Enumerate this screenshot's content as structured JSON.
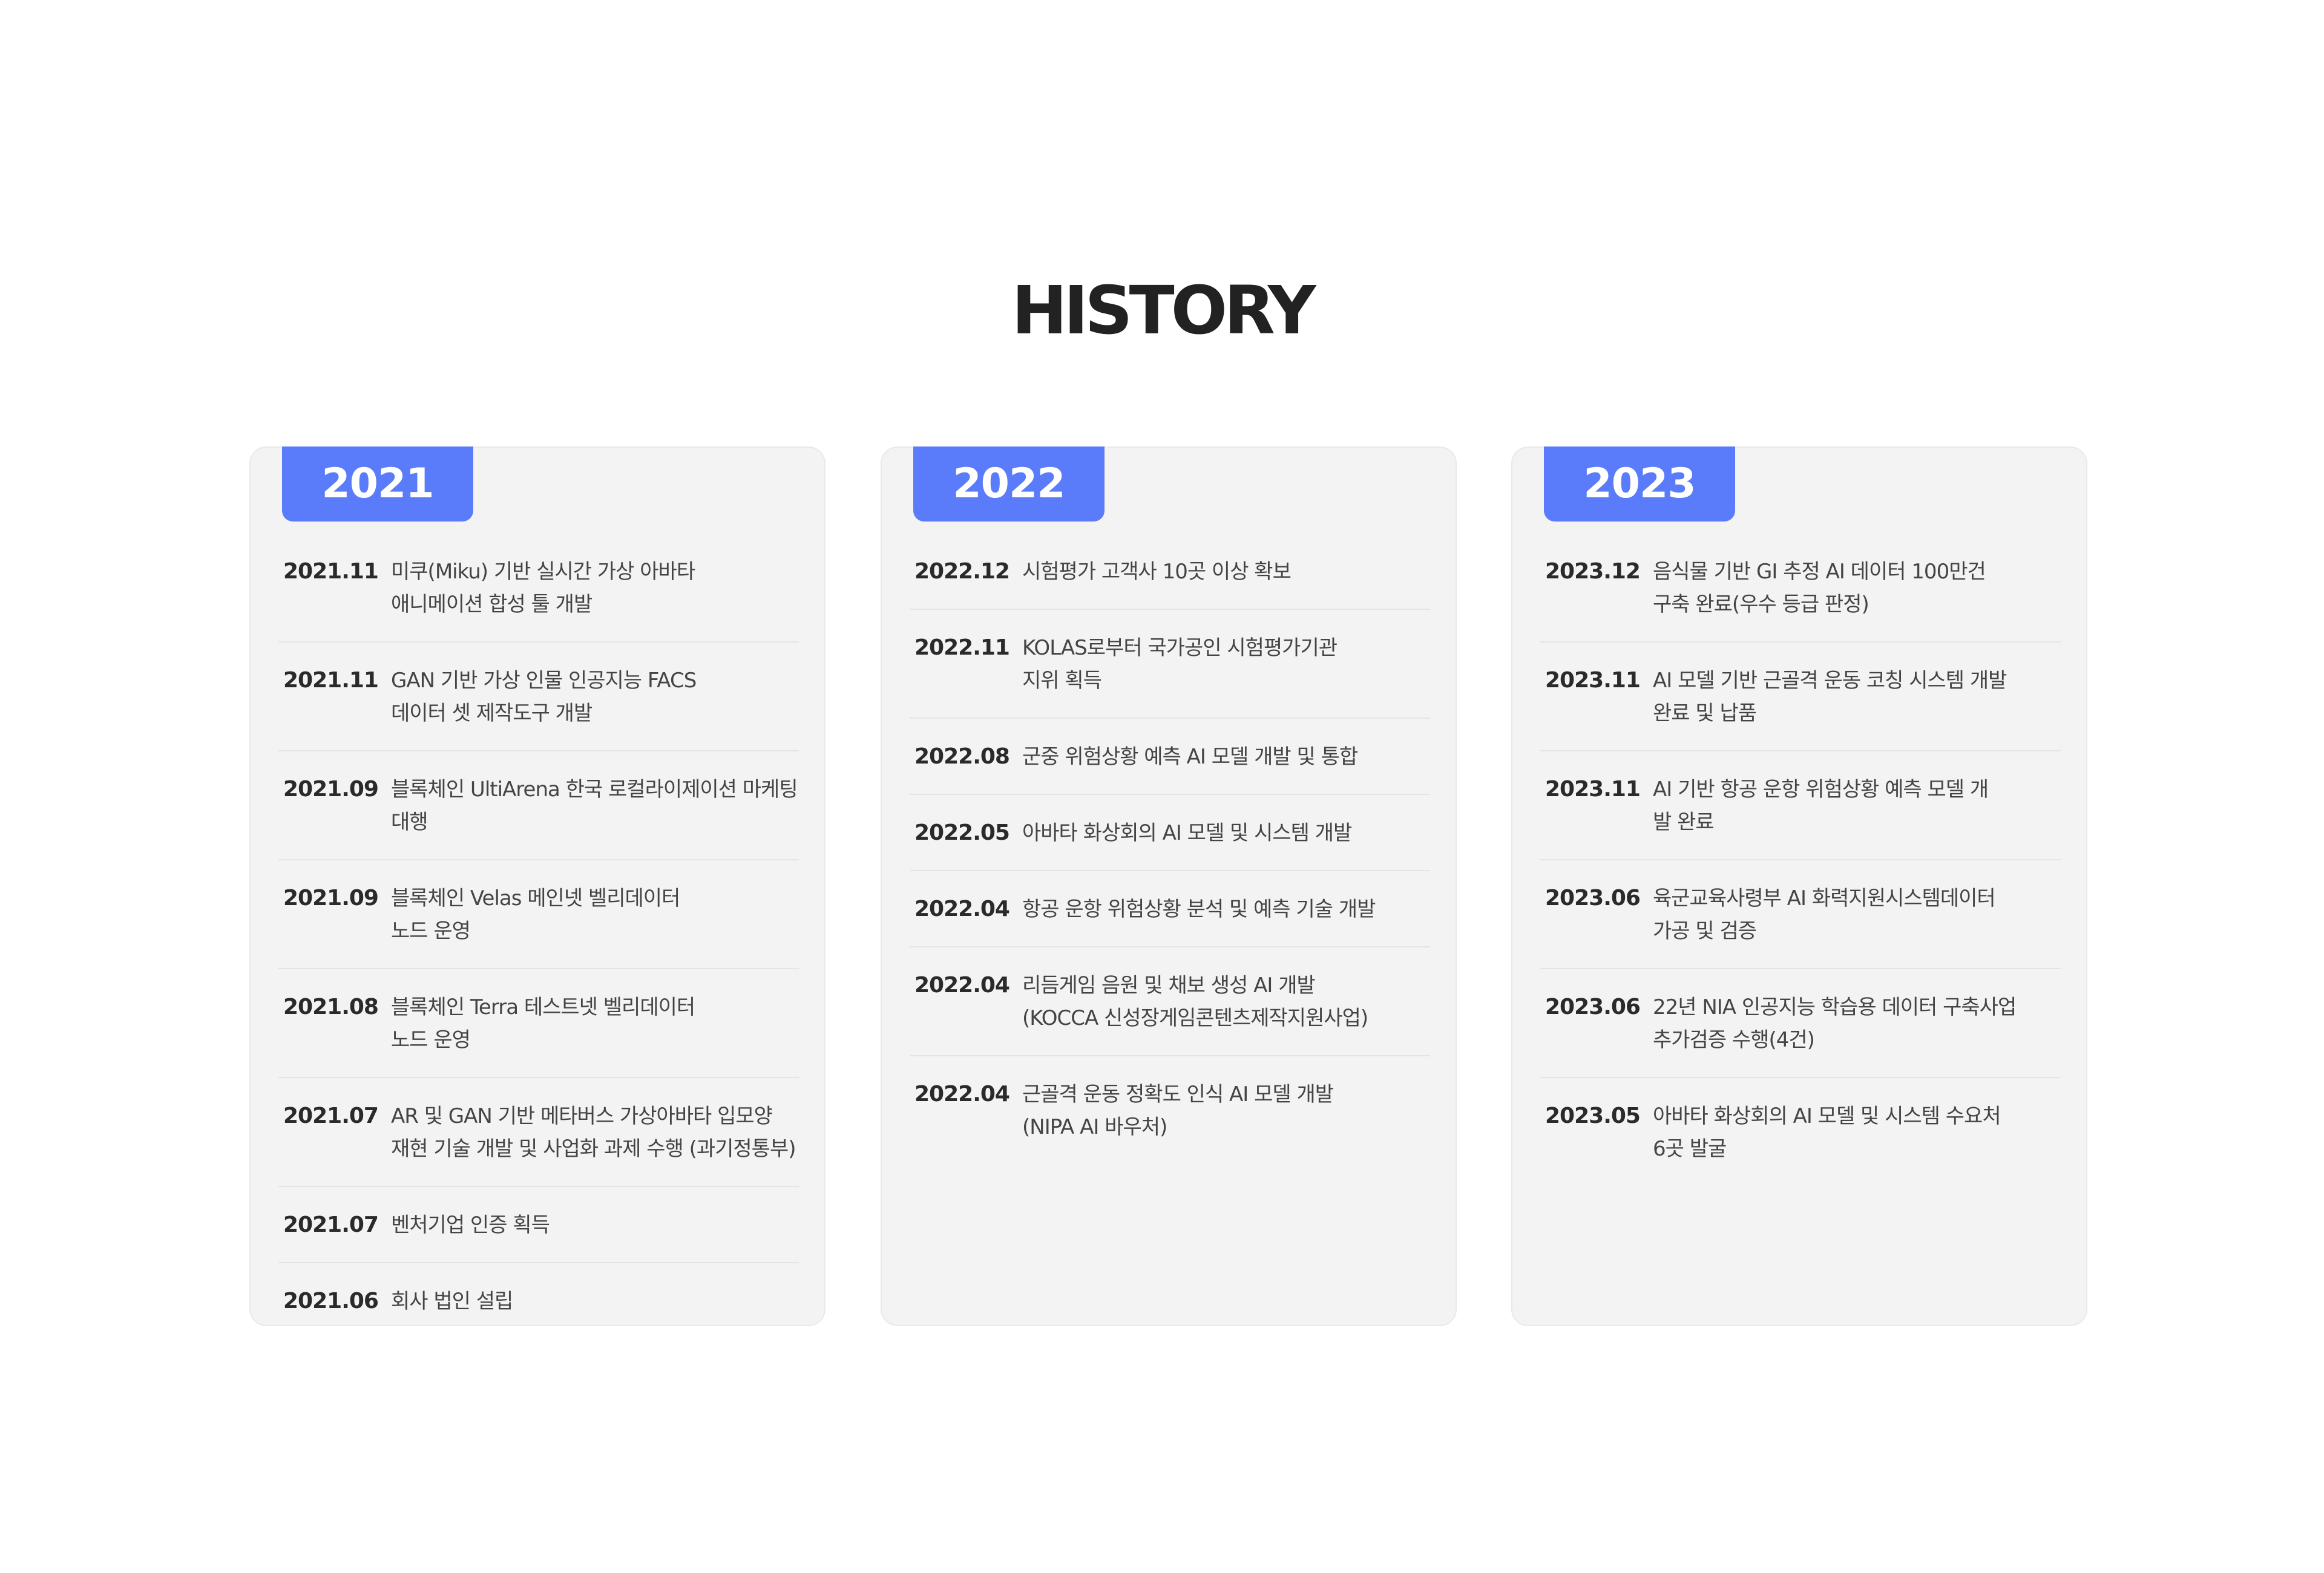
{
  "page": {
    "title": "HISTORY"
  },
  "colors": {
    "accent": "#5b7cfa",
    "card_background": "#f3f3f3",
    "divider": "#e4e4e4",
    "title_text": "#222222",
    "body_text": "#444444"
  },
  "columns": [
    {
      "year": "2021",
      "entries": [
        {
          "date": "2021.11",
          "text": "미쿠(Miku) 기반 실시간 가상 아바타\n애니메이션 합성 툴 개발"
        },
        {
          "date": "2021.11",
          "text": "GAN 기반 가상 인물 인공지능 FACS\n데이터 셋 제작도구 개발"
        },
        {
          "date": "2021.09",
          "text": "블록체인 UltiArena 한국 로컬라이제이션 마케팅\n대행"
        },
        {
          "date": "2021.09",
          "text": "블록체인 Velas 메인넷 벨리데이터\n노드 운영"
        },
        {
          "date": "2021.08",
          "text": "블록체인 Terra 테스트넷 벨리데이터\n노드 운영"
        },
        {
          "date": "2021.07",
          "text": "AR 및 GAN 기반 메타버스 가상아바타 입모양\n재현 기술 개발 및 사업화 과제 수행 (과기정통부)"
        },
        {
          "date": "2021.07",
          "text": "벤처기업 인증 획득"
        },
        {
          "date": "2021.06",
          "text": "회사 법인 설립"
        }
      ]
    },
    {
      "year": "2022",
      "entries": [
        {
          "date": "2022.12",
          "text": "시험평가 고객사 10곳 이상 확보"
        },
        {
          "date": "2022.11",
          "text": "KOLAS로부터 국가공인 시험평가기관\n지위 획득"
        },
        {
          "date": "2022.08",
          "text": "군중 위험상황 예측 AI 모델 개발 및 통합"
        },
        {
          "date": "2022.05",
          "text": "아바타 화상회의 AI 모델 및 시스템 개발"
        },
        {
          "date": "2022.04",
          "text": "항공 운항 위험상황 분석 및 예측 기술 개발"
        },
        {
          "date": "2022.04",
          "text": "리듬게임 음원 및 채보 생성 AI 개발\n(KOCCA 신성장게임콘텐츠제작지원사업)"
        },
        {
          "date": "2022.04",
          "text": "근골격 운동 정확도 인식 AI 모델 개발\n(NIPA AI 바우처)"
        }
      ]
    },
    {
      "year": "2023",
      "entries": [
        {
          "date": "2023.12",
          "text": "음식물 기반 GI 추정 AI 데이터 100만건\n구축 완료(우수 등급 판정)"
        },
        {
          "date": "2023.11",
          "text": "AI 모델 기반 근골격 운동 코칭 시스템 개발\n완료 및 납품"
        },
        {
          "date": "2023.11",
          "text": "AI 기반 항공 운항 위험상황 예측 모델 개\n발 완료"
        },
        {
          "date": "2023.06",
          "text": "육군교육사령부 AI 화력지원시스템데이터\n가공 및 검증"
        },
        {
          "date": "2023.06",
          "text": "22년 NIA 인공지능 학습용 데이터 구축사업\n추가검증 수행(4건)"
        },
        {
          "date": "2023.05",
          "text": "아바타 화상회의 AI 모델 및 시스템 수요처\n6곳 발굴"
        }
      ]
    }
  ]
}
